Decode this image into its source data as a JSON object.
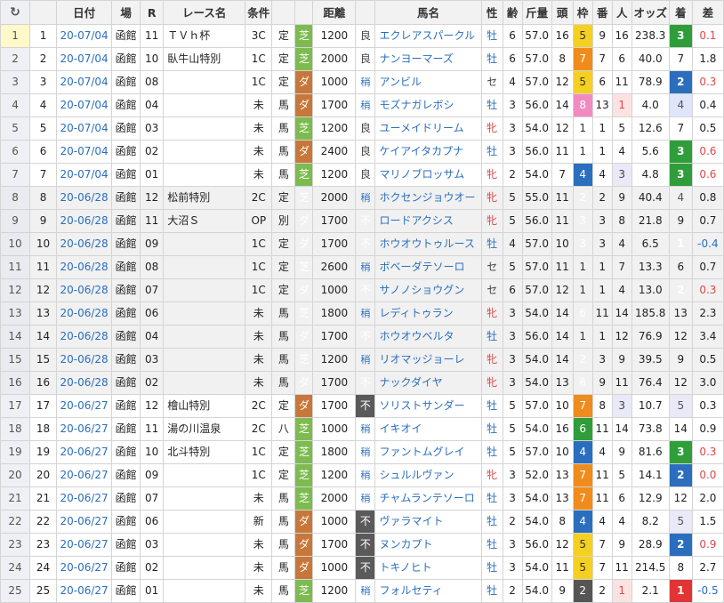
{
  "headers": [
    "日付",
    "場",
    "R",
    "レース名",
    "条件",
    "",
    "",
    "距離",
    "",
    "馬名",
    "性",
    "齢",
    "斤量",
    "頭",
    "枠",
    "番",
    "人",
    "オッズ",
    "着",
    "差"
  ],
  "refresh_glyph": "↻",
  "colors": {
    "turf": "#7dbb4f",
    "dirt": "#c8773a",
    "bad_track": "#5a5a5a",
    "frame1": "#ffffff",
    "frame2": "#555555",
    "frame3": "#e23434",
    "frame4": "#2a6ebd",
    "frame5": "#f5d020",
    "frame6": "#2f9e3a",
    "frame7": "#f08c1c",
    "frame8": "#f28ac2",
    "link": "#2a6ebd",
    "female": "#e04848"
  },
  "rows": [
    {
      "idx": "1",
      "no": "1",
      "date": "20-07/04",
      "track": "函館",
      "r": "11",
      "race": "ＴＶｈ杯",
      "cls": "3C",
      "rule": "定",
      "sfc": "芝",
      "dist": "1200",
      "cond": "良",
      "horse": "エクレアスパークル",
      "sex": "牡",
      "age": "6",
      "wt": "57.0",
      "heads": "16",
      "frame": "5",
      "num": "9",
      "pop": "16",
      "odds": "238.3",
      "fin": "3",
      "margin": "0.1"
    },
    {
      "idx": "2",
      "no": "2",
      "date": "20-07/04",
      "track": "函館",
      "r": "10",
      "race": "臥牛山特別",
      "cls": "1C",
      "rule": "定",
      "sfc": "芝",
      "dist": "2000",
      "cond": "良",
      "horse": "ナンヨーマーズ",
      "sex": "牡",
      "age": "6",
      "wt": "57.0",
      "heads": "8",
      "frame": "7",
      "num": "7",
      "pop": "6",
      "odds": "40.0",
      "fin": "7",
      "margin": "1.8"
    },
    {
      "idx": "3",
      "no": "3",
      "date": "20-07/04",
      "track": "函館",
      "r": "08",
      "race": "",
      "cls": "1C",
      "rule": "定",
      "sfc": "ダ",
      "dist": "1000",
      "cond": "稍",
      "horse": "アンビル",
      "sex": "セ",
      "age": "4",
      "wt": "57.0",
      "heads": "12",
      "frame": "5",
      "num": "6",
      "pop": "11",
      "odds": "78.9",
      "fin": "2",
      "margin": "0.3"
    },
    {
      "idx": "4",
      "no": "4",
      "date": "20-07/04",
      "track": "函館",
      "r": "04",
      "race": "",
      "cls": "未",
      "rule": "馬",
      "sfc": "ダ",
      "dist": "1700",
      "cond": "稍",
      "horse": "モズナガレボシ",
      "sex": "牡",
      "age": "3",
      "wt": "56.0",
      "heads": "14",
      "frame": "8",
      "num": "13",
      "pop": "1",
      "odds": "4.0",
      "fin": "4",
      "margin": "0.4"
    },
    {
      "idx": "5",
      "no": "5",
      "date": "20-07/04",
      "track": "函館",
      "r": "03",
      "race": "",
      "cls": "未",
      "rule": "馬",
      "sfc": "芝",
      "dist": "1200",
      "cond": "良",
      "horse": "ユーメイドリーム",
      "sex": "牝",
      "age": "3",
      "wt": "54.0",
      "heads": "12",
      "frame": "1",
      "num": "1",
      "pop": "5",
      "odds": "12.6",
      "fin": "7",
      "margin": "0.5"
    },
    {
      "idx": "6",
      "no": "6",
      "date": "20-07/04",
      "track": "函館",
      "r": "02",
      "race": "",
      "cls": "未",
      "rule": "馬",
      "sfc": "ダ",
      "dist": "2400",
      "cond": "良",
      "horse": "ケイアイタカプナ",
      "sex": "牡",
      "age": "3",
      "wt": "56.0",
      "heads": "11",
      "frame": "1",
      "num": "1",
      "pop": "4",
      "odds": "5.6",
      "fin": "3",
      "margin": "0.6"
    },
    {
      "idx": "7",
      "no": "7",
      "date": "20-07/04",
      "track": "函館",
      "r": "01",
      "race": "",
      "cls": "未",
      "rule": "馬",
      "sfc": "芝",
      "dist": "1200",
      "cond": "良",
      "horse": "マリノブロッサム",
      "sex": "牝",
      "age": "2",
      "wt": "54.0",
      "heads": "7",
      "frame": "4",
      "num": "4",
      "pop": "3",
      "odds": "4.8",
      "fin": "3",
      "margin": "0.6"
    },
    {
      "idx": "8",
      "no": "8",
      "date": "20-06/28",
      "track": "函館",
      "r": "12",
      "race": "松前特別",
      "cls": "2C",
      "rule": "定",
      "sfc": "芝",
      "dist": "2000",
      "cond": "稍",
      "horse": "ホクセンジョウオー",
      "sex": "牝",
      "age": "5",
      "wt": "55.0",
      "heads": "11",
      "frame": "2",
      "num": "2",
      "pop": "9",
      "odds": "40.4",
      "fin": "4",
      "margin": "0.8",
      "hl": true
    },
    {
      "idx": "9",
      "no": "9",
      "date": "20-06/28",
      "track": "函館",
      "r": "11",
      "race": "大沼Ｓ",
      "cls": "OP",
      "rule": "別",
      "sfc": "ダ",
      "dist": "1700",
      "cond": "不",
      "horse": "ロードアクシス",
      "sex": "牝",
      "age": "5",
      "wt": "56.0",
      "heads": "11",
      "frame": "3",
      "num": "3",
      "pop": "8",
      "odds": "21.8",
      "fin": "9",
      "margin": "0.7",
      "hl": true
    },
    {
      "idx": "10",
      "no": "10",
      "date": "20-06/28",
      "track": "函館",
      "r": "09",
      "race": "",
      "cls": "1C",
      "rule": "定",
      "sfc": "ダ",
      "dist": "1700",
      "cond": "不",
      "horse": "ホウオウトゥルース",
      "sex": "牡",
      "age": "4",
      "wt": "57.0",
      "heads": "10",
      "frame": "3",
      "num": "3",
      "pop": "4",
      "odds": "6.5",
      "fin": "1",
      "margin": "-0.4",
      "hl": true
    },
    {
      "idx": "11",
      "no": "11",
      "date": "20-06/28",
      "track": "函館",
      "r": "08",
      "race": "",
      "cls": "1C",
      "rule": "定",
      "sfc": "芝",
      "dist": "2600",
      "cond": "稍",
      "horse": "ボベーダテソーロ",
      "sex": "セ",
      "age": "5",
      "wt": "57.0",
      "heads": "11",
      "frame": "1",
      "num": "1",
      "pop": "7",
      "odds": "13.3",
      "fin": "6",
      "margin": "0.7",
      "hl": true
    },
    {
      "idx": "12",
      "no": "12",
      "date": "20-06/28",
      "track": "函館",
      "r": "07",
      "race": "",
      "cls": "1C",
      "rule": "定",
      "sfc": "ダ",
      "dist": "1000",
      "cond": "不",
      "horse": "サノノショウグン",
      "sex": "セ",
      "age": "6",
      "wt": "57.0",
      "heads": "12",
      "frame": "1",
      "num": "1",
      "pop": "4",
      "odds": "13.0",
      "fin": "2",
      "margin": "0.3",
      "hl": true
    },
    {
      "idx": "13",
      "no": "13",
      "date": "20-06/28",
      "track": "函館",
      "r": "06",
      "race": "",
      "cls": "未",
      "rule": "馬",
      "sfc": "芝",
      "dist": "1800",
      "cond": "稍",
      "horse": "レディトゥラン",
      "sex": "牝",
      "age": "3",
      "wt": "54.0",
      "heads": "14",
      "frame": "6",
      "num": "11",
      "pop": "14",
      "odds": "185.8",
      "fin": "13",
      "margin": "2.3",
      "hl": true
    },
    {
      "idx": "14",
      "no": "14",
      "date": "20-06/28",
      "track": "函館",
      "r": "04",
      "race": "",
      "cls": "未",
      "rule": "馬",
      "sfc": "ダ",
      "dist": "1700",
      "cond": "不",
      "horse": "ホウオウベルタ",
      "sex": "牡",
      "age": "3",
      "wt": "56.0",
      "heads": "14",
      "frame": "1",
      "num": "1",
      "pop": "12",
      "odds": "76.9",
      "fin": "12",
      "margin": "3.4",
      "hl": true
    },
    {
      "idx": "15",
      "no": "15",
      "date": "20-06/28",
      "track": "函館",
      "r": "03",
      "race": "",
      "cls": "未",
      "rule": "馬",
      "sfc": "芝",
      "dist": "1200",
      "cond": "稍",
      "horse": "リオマッジョーレ",
      "sex": "牝",
      "age": "3",
      "wt": "54.0",
      "heads": "14",
      "frame": "2",
      "num": "3",
      "pop": "9",
      "odds": "39.5",
      "fin": "9",
      "margin": "0.5",
      "hl": true
    },
    {
      "idx": "16",
      "no": "16",
      "date": "20-06/28",
      "track": "函館",
      "r": "02",
      "race": "",
      "cls": "未",
      "rule": "馬",
      "sfc": "ダ",
      "dist": "1700",
      "cond": "不",
      "horse": "ナックダイヤ",
      "sex": "牝",
      "age": "3",
      "wt": "54.0",
      "heads": "13",
      "frame": "6",
      "num": "9",
      "pop": "11",
      "odds": "76.4",
      "fin": "12",
      "margin": "3.0",
      "hl": true
    },
    {
      "idx": "17",
      "no": "17",
      "date": "20-06/27",
      "track": "函館",
      "r": "12",
      "race": "檜山特別",
      "cls": "2C",
      "rule": "定",
      "sfc": "ダ",
      "dist": "1700",
      "cond": "不",
      "horse": "ソリストサンダー",
      "sex": "牡",
      "age": "5",
      "wt": "57.0",
      "heads": "10",
      "frame": "7",
      "num": "8",
      "pop": "3",
      "odds": "10.7",
      "fin": "5",
      "margin": "0.3"
    },
    {
      "idx": "18",
      "no": "18",
      "date": "20-06/27",
      "track": "函館",
      "r": "11",
      "race": "湯の川温泉",
      "cls": "2C",
      "rule": "八",
      "sfc": "芝",
      "dist": "1000",
      "cond": "稍",
      "horse": "イキオイ",
      "sex": "牡",
      "age": "5",
      "wt": "54.0",
      "heads": "16",
      "frame": "6",
      "num": "11",
      "pop": "14",
      "odds": "73.8",
      "fin": "14",
      "margin": "0.9"
    },
    {
      "idx": "19",
      "no": "19",
      "date": "20-06/27",
      "track": "函館",
      "r": "10",
      "race": "北斗特別",
      "cls": "1C",
      "rule": "定",
      "sfc": "芝",
      "dist": "1800",
      "cond": "稍",
      "horse": "ファントムグレイ",
      "sex": "牡",
      "age": "5",
      "wt": "57.0",
      "heads": "10",
      "frame": "4",
      "num": "4",
      "pop": "9",
      "odds": "81.6",
      "fin": "3",
      "margin": "0.3"
    },
    {
      "idx": "20",
      "no": "20",
      "date": "20-06/27",
      "track": "函館",
      "r": "09",
      "race": "",
      "cls": "1C",
      "rule": "定",
      "sfc": "芝",
      "dist": "1200",
      "cond": "稍",
      "horse": "シュルルヴァン",
      "sex": "牝",
      "age": "3",
      "wt": "52.0",
      "heads": "13",
      "frame": "7",
      "num": "11",
      "pop": "5",
      "odds": "14.1",
      "fin": "2",
      "margin": "0.0"
    },
    {
      "idx": "21",
      "no": "21",
      "date": "20-06/27",
      "track": "函館",
      "r": "07",
      "race": "",
      "cls": "未",
      "rule": "馬",
      "sfc": "芝",
      "dist": "2000",
      "cond": "稍",
      "horse": "チャムランテソーロ",
      "sex": "牡",
      "age": "3",
      "wt": "54.0",
      "heads": "13",
      "frame": "7",
      "num": "11",
      "pop": "6",
      "odds": "12.9",
      "fin": "12",
      "margin": "2.0"
    },
    {
      "idx": "22",
      "no": "22",
      "date": "20-06/27",
      "track": "函館",
      "r": "06",
      "race": "",
      "cls": "新",
      "rule": "馬",
      "sfc": "ダ",
      "dist": "1000",
      "cond": "不",
      "horse": "ヴァラマイト",
      "sex": "牡",
      "age": "2",
      "wt": "54.0",
      "heads": "8",
      "frame": "4",
      "num": "4",
      "pop": "4",
      "odds": "8.2",
      "fin": "5",
      "margin": "1.5"
    },
    {
      "idx": "23",
      "no": "23",
      "date": "20-06/27",
      "track": "函館",
      "r": "03",
      "race": "",
      "cls": "未",
      "rule": "馬",
      "sfc": "ダ",
      "dist": "1700",
      "cond": "不",
      "horse": "ヌンカプト",
      "sex": "牡",
      "age": "3",
      "wt": "56.0",
      "heads": "12",
      "frame": "5",
      "num": "7",
      "pop": "9",
      "odds": "28.9",
      "fin": "2",
      "margin": "0.9"
    },
    {
      "idx": "24",
      "no": "24",
      "date": "20-06/27",
      "track": "函館",
      "r": "02",
      "race": "",
      "cls": "未",
      "rule": "馬",
      "sfc": "ダ",
      "dist": "1000",
      "cond": "不",
      "horse": "トキノヒト",
      "sex": "牡",
      "age": "3",
      "wt": "54.0",
      "heads": "11",
      "frame": "5",
      "num": "7",
      "pop": "11",
      "odds": "214.5",
      "fin": "8",
      "margin": "2.7"
    },
    {
      "idx": "25",
      "no": "25",
      "date": "20-06/27",
      "track": "函館",
      "r": "01",
      "race": "",
      "cls": "未",
      "rule": "馬",
      "sfc": "芝",
      "dist": "1200",
      "cond": "稍",
      "horse": "フォルセティ",
      "sex": "牡",
      "age": "2",
      "wt": "54.0",
      "heads": "9",
      "frame": "2",
      "num": "2",
      "pop": "1",
      "odds": "2.1",
      "fin": "1",
      "margin": "-0.5"
    }
  ]
}
